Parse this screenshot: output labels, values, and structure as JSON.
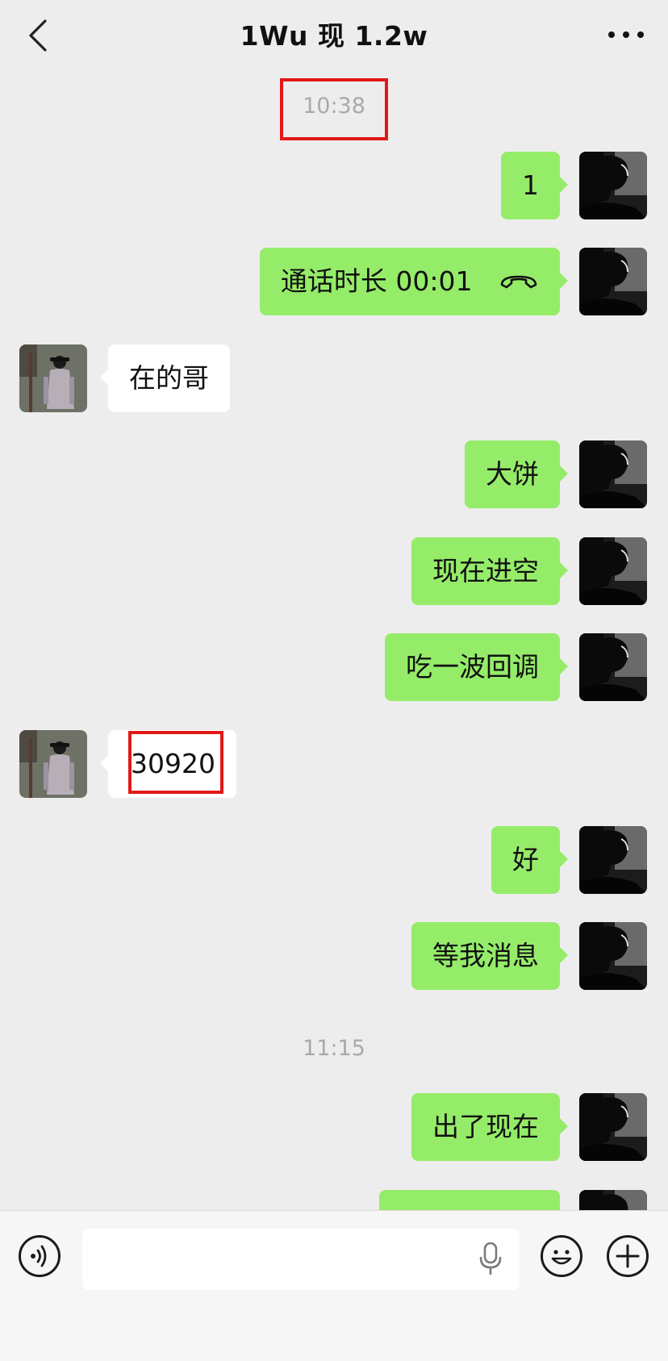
{
  "header": {
    "title": "1Wu 现 1.2w",
    "back_icon": "chevron-left-icon",
    "more_icon": "ellipsis-icon"
  },
  "timestamps": [
    "10:38",
    "11:15"
  ],
  "messages": [
    {
      "side": "right",
      "text": "1"
    },
    {
      "side": "right",
      "text": "通话时长 00:01",
      "icon": "phone-hangup-icon"
    },
    {
      "side": "left",
      "text": "在的哥"
    },
    {
      "side": "right",
      "text": "大饼"
    },
    {
      "side": "right",
      "text": "现在进空"
    },
    {
      "side": "right",
      "text": "吃一波回调"
    },
    {
      "side": "left",
      "text": "30920"
    },
    {
      "side": "right",
      "text": "好"
    },
    {
      "side": "right",
      "text": "等我消息"
    },
    {
      "side": "right",
      "text": "出了现在"
    },
    {
      "side": "right",
      "text": ""
    }
  ],
  "input_bar": {
    "voice_icon": "voice-icon",
    "input_value": "",
    "mic_icon": "microphone-icon",
    "emoji_icon": "emoji-icon",
    "plus_icon": "plus-icon"
  },
  "colors": {
    "background": "#ededed",
    "sent_bubble": "#95ec69",
    "received_bubble": "#ffffff",
    "highlight": "#e21818",
    "timestamp": "#a9a9a9"
  }
}
